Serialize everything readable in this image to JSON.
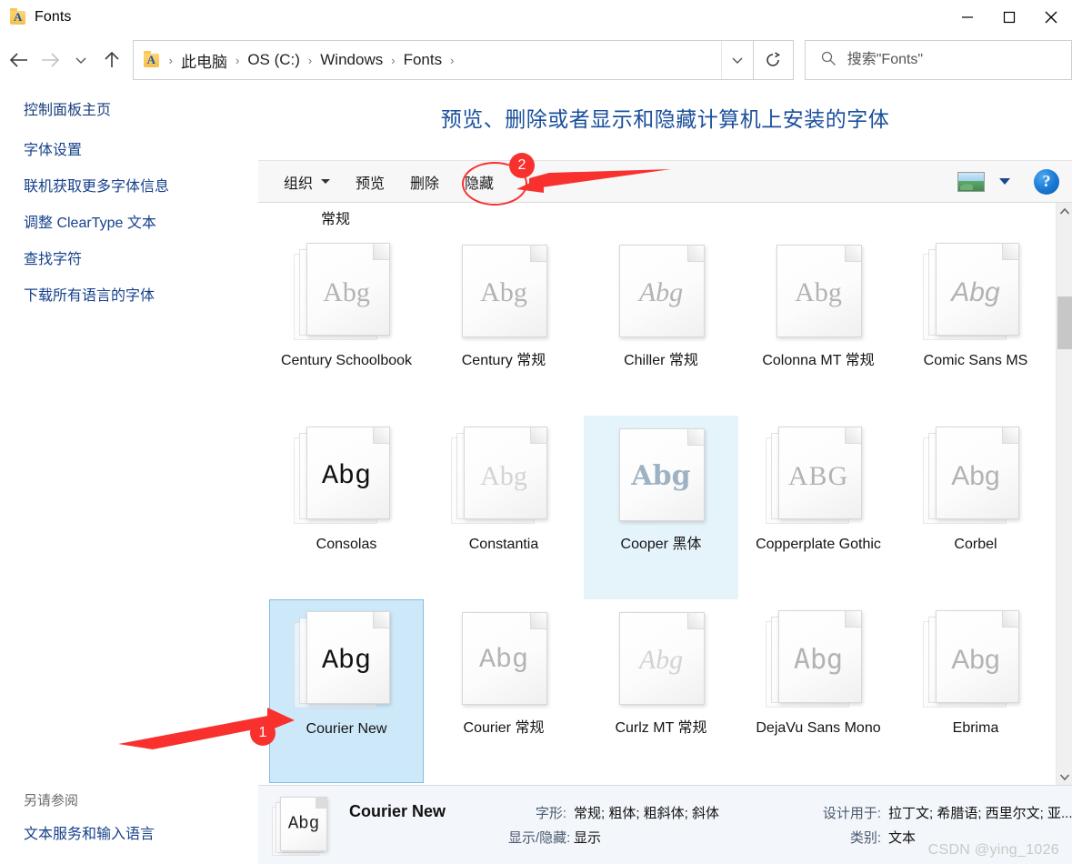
{
  "window": {
    "title": "Fonts",
    "icon": "fonts-folder-icon",
    "controls": {
      "minimize": "minimize-icon",
      "maximize": "maximize-icon",
      "close": "close-icon"
    }
  },
  "nav": {
    "back": "back-arrow-icon",
    "forward": "forward-arrow-icon",
    "recent": "chevron-down-icon",
    "up": "up-arrow-icon",
    "breadcrumbs": [
      "此电脑",
      "OS (C:)",
      "Windows",
      "Fonts"
    ],
    "separator": "›",
    "address_dropdown": "chevron-down-icon",
    "refresh": "refresh-icon"
  },
  "search": {
    "icon": "search-icon",
    "placeholder": "搜索\"Fonts\"",
    "value": ""
  },
  "sidebar": {
    "home": "控制面板主页",
    "links": [
      "字体设置",
      "联机获取更多字体信息",
      "调整 ClearType 文本",
      "查找字符",
      "下载所有语言的字体"
    ],
    "see_also_label": "另请参阅",
    "see_also_links": [
      "文本服务和输入语言"
    ]
  },
  "content": {
    "heading": "预览、删除或者显示和隐藏计算机上安装的字体"
  },
  "toolbar": {
    "organize": "组织",
    "preview": "预览",
    "delete": "删除",
    "hide": "隐藏",
    "view_icon": "view-layout-icon",
    "view_caret": "chevron-down-icon",
    "help": "?"
  },
  "grid": {
    "partial_row_label": "常规",
    "items": [
      {
        "name": "Century Schoolbook",
        "sample": "Abg",
        "style": "serif",
        "stacked": true,
        "tone": "light",
        "state": "normal"
      },
      {
        "name": "Century 常规",
        "sample": "Abg",
        "style": "serif",
        "stacked": false,
        "tone": "light",
        "state": "normal"
      },
      {
        "name": "Chiller 常规",
        "sample": "Abg",
        "style": "chiller",
        "stacked": false,
        "tone": "light",
        "state": "normal"
      },
      {
        "name": "Colonna MT 常规",
        "sample": "Abg",
        "style": "colonna",
        "stacked": false,
        "tone": "light",
        "state": "normal"
      },
      {
        "name": "Comic Sans MS",
        "sample": "Abg",
        "style": "comic",
        "stacked": true,
        "tone": "light",
        "state": "normal"
      },
      {
        "name": "Consolas",
        "sample": "Abg",
        "style": "mono",
        "stacked": true,
        "tone": "dark",
        "state": "normal"
      },
      {
        "name": "Constantia",
        "sample": "Abg",
        "style": "serif",
        "stacked": true,
        "tone": "faint",
        "state": "normal"
      },
      {
        "name": "Cooper 黑体",
        "sample": "Abg",
        "style": "cooper",
        "stacked": false,
        "tone": "light",
        "state": "highlight"
      },
      {
        "name": "Copperplate Gothic",
        "sample": "ABG",
        "style": "caps",
        "stacked": true,
        "tone": "light",
        "state": "normal"
      },
      {
        "name": "Corbel",
        "sample": "Abg",
        "style": "sans",
        "stacked": true,
        "tone": "light",
        "state": "normal"
      },
      {
        "name": "Courier New",
        "sample": "Abg",
        "style": "mono",
        "stacked": true,
        "tone": "dark",
        "state": "selected"
      },
      {
        "name": "Courier 常规",
        "sample": "Abg",
        "style": "mono",
        "stacked": false,
        "tone": "light",
        "state": "normal"
      },
      {
        "name": "Curlz MT 常规",
        "sample": "Abg",
        "style": "curlz",
        "stacked": false,
        "tone": "faint",
        "state": "normal"
      },
      {
        "name": "DejaVu Sans Mono",
        "sample": "Abg",
        "style": "djvmono",
        "stacked": true,
        "tone": "light",
        "state": "normal"
      },
      {
        "name": "Ebrima",
        "sample": "Abg",
        "style": "sans",
        "stacked": true,
        "tone": "light",
        "state": "normal"
      }
    ],
    "scroll_up": "chevron-up-icon",
    "scroll_down": "chevron-down-icon"
  },
  "details": {
    "icon": "font-file-icon",
    "name": "Courier New",
    "fields": [
      {
        "label": "字形:",
        "value": "常规; 粗体; 粗斜体; 斜体"
      },
      {
        "label": "设计用于:",
        "value": "拉丁文; 希腊语; 西里尔文; 亚..."
      },
      {
        "label": "显示/隐藏:",
        "value": "显示"
      },
      {
        "label": "类别:",
        "value": "文本"
      }
    ],
    "watermark": "CSDN @ying_1026"
  },
  "annotations": {
    "badge_one": "1",
    "badge_two": "2",
    "accent_color": "#f8312f"
  }
}
